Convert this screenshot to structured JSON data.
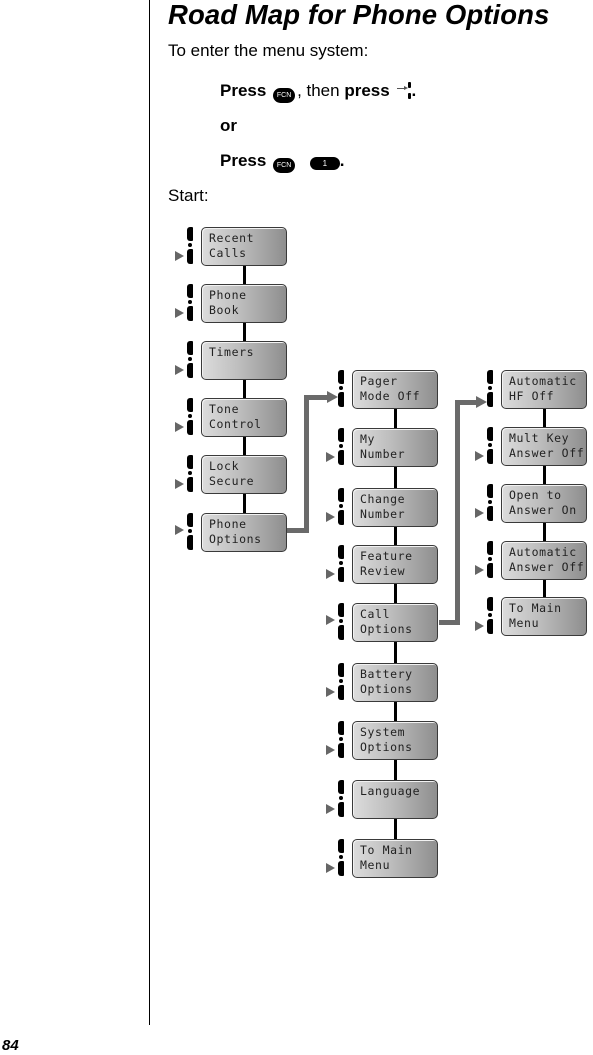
{
  "page": {
    "number": "84",
    "title": "Road Map for Phone Options",
    "intro": "To enter the menu system:",
    "instructions": [
      {
        "prefix": "Press",
        "key1": "FCN",
        "middle": ", then",
        "action": "press",
        "suffix": "."
      },
      {
        "text": "or"
      },
      {
        "prefix": "Press",
        "key1": "FCN",
        "key2": "1",
        "suffix": "."
      }
    ],
    "start_label": "Start:"
  },
  "menu": {
    "main": [
      {
        "label": "Recent\nCalls",
        "arrow": "bottom"
      },
      {
        "label": "Phone\nBook",
        "arrow": "bottom"
      },
      {
        "label": "Timers",
        "arrow": "bottom"
      },
      {
        "label": "Tone\nControl",
        "arrow": "bottom"
      },
      {
        "label": "Lock\nSecure",
        "arrow": "bottom"
      },
      {
        "label": "Phone\nOptions",
        "arrow": "middle"
      }
    ],
    "phone_options": [
      {
        "label": "Pager\nMode Off",
        "arrow": "entry"
      },
      {
        "label": "My\nNumber",
        "arrow": "bottom"
      },
      {
        "label": "Change\nNumber",
        "arrow": "bottom"
      },
      {
        "label": "Feature\nReview",
        "arrow": "bottom"
      },
      {
        "label": "Call\nOptions",
        "arrow": "middle"
      },
      {
        "label": "Battery\nOptions",
        "arrow": "bottom"
      },
      {
        "label": "System\nOptions",
        "arrow": "bottom"
      },
      {
        "label": "Language",
        "arrow": "bottom"
      },
      {
        "label": "To Main\nMenu",
        "arrow": "bottom"
      }
    ],
    "call_options": [
      {
        "label": "Automatic\nHF Off",
        "arrow": "entry"
      },
      {
        "label": "Mult Key\nAnswer Off",
        "arrow": "bottom"
      },
      {
        "label": "Open to\nAnswer On",
        "arrow": "bottom"
      },
      {
        "label": "Automatic\nAnswer Off",
        "arrow": "bottom"
      },
      {
        "label": "To Main\nMenu",
        "arrow": "bottom"
      }
    ]
  },
  "colors": {
    "connector": "#6a6a6a",
    "box_light": "#dcdcdc",
    "box_dark": "#8e8e8e",
    "text": "#000000"
  }
}
